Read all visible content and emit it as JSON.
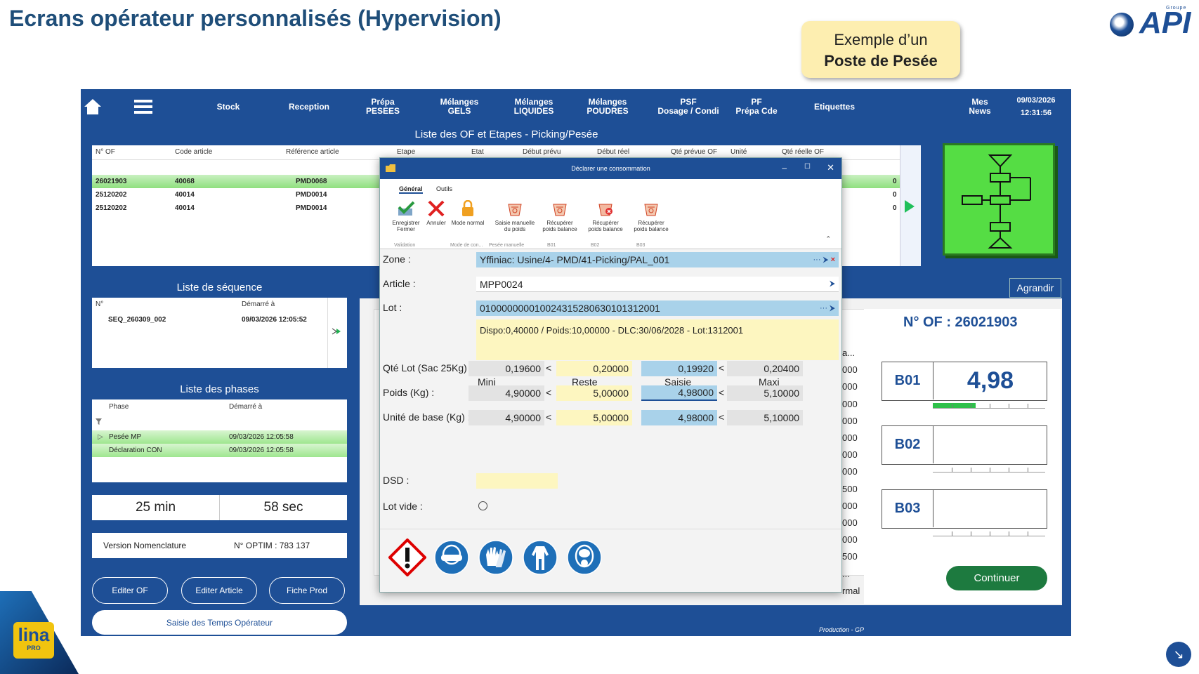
{
  "slide": {
    "title": "Ecrans opérateur personnalisés (Hypervision)",
    "callout_line1": "Exemple d’un",
    "callout_line2": "Poste de Pesée",
    "logo_text": "API",
    "logo_group": "Groupe",
    "lina": "lina",
    "lina_sub": "PRO"
  },
  "nav": {
    "items": [
      "Stock",
      "Reception",
      "Prépa\nPESEES",
      "Mélanges\nGELS",
      "Mélanges\nLIQUIDES",
      "Mélanges\nPOUDRES",
      "PSF\nDosage / Condi",
      "PF\nPrépa Cde",
      "Etiquettes"
    ],
    "news": "Mes\nNews",
    "date": "09/03/2026",
    "time": "12:31:56"
  },
  "of_list": {
    "title": "Liste des OF et Etapes - Picking/Pesée",
    "columns": [
      "N° OF",
      "Code article",
      "Référence article",
      "Etape",
      "Etat",
      "Début prévu",
      "Début réel",
      "Qté prévue OF",
      "Unité",
      "Qté réelle OF"
    ],
    "rows": [
      {
        "of": "26021903",
        "code": "40068",
        "ref": "PMD0068",
        "qte": "0"
      },
      {
        "of": "25120202",
        "code": "40014",
        "ref": "PMD0014",
        "qte": "0"
      },
      {
        "of": "25120202",
        "code": "40014",
        "ref": "PMD0014",
        "qte": "0"
      }
    ]
  },
  "sequence": {
    "title": "Liste de séquence",
    "col_n": "N°",
    "col_start": "Démarré à",
    "row_n": "SEQ_260309_002",
    "row_start": "09/03/2026 12:05:52"
  },
  "phases": {
    "title": "Liste des phases",
    "col_phase": "Phase",
    "col_start": "Démarré à",
    "rows": [
      {
        "phase": "Pesée  MP",
        "start": "09/03/2026 12:05:58"
      },
      {
        "phase": "Déclaration CON",
        "start": "09/03/2026 12:05:58"
      }
    ]
  },
  "timer": {
    "min": "25 min",
    "sec": "58 sec"
  },
  "info": {
    "version": "Version Nomenclature",
    "optim": "N° OPTIM : 783 137"
  },
  "buttons": {
    "editer_of": "Editer OF",
    "editer_article": "Editer Article",
    "fiche_prod": "Fiche Prod",
    "saisie_temps": "Saisie des Temps Opérateur",
    "agrandir": "Agrandir",
    "continuer": "Continuer"
  },
  "right": {
    "of_label": "N° OF : 26021903",
    "footer": "Production - GP",
    "balances": [
      {
        "name": "B01",
        "value": "4,98",
        "fill": 0.38
      },
      {
        "name": "B02",
        "value": "",
        "fill": 0
      },
      {
        "name": "B03",
        "value": "",
        "fill": 0
      }
    ]
  },
  "background_values": [
    "a...",
    "000",
    "000",
    "000",
    "000",
    "000",
    "000",
    "000",
    "500",
    "000",
    "000",
    "000",
    "500",
    "...",
    "rmal"
  ],
  "dialog": {
    "title": "Déclarer une consommation",
    "tabs": [
      "Général",
      "Outils"
    ],
    "ribbon": [
      {
        "label": "Enregistrer\nFermer",
        "icon": "save-check-icon"
      },
      {
        "label": "Annuler",
        "icon": "cancel-x-icon"
      },
      {
        "label": "Mode normal",
        "icon": "lock-icon"
      },
      {
        "label": "Saisie manuelle\ndu poids",
        "icon": "scale-icon"
      },
      {
        "label": "Récupérer\npoids balance",
        "icon": "scale-icon"
      },
      {
        "label": "Récupérer\npoids balance",
        "icon": "scale-error-icon"
      },
      {
        "label": "Récupérer\npoids balance",
        "icon": "scale-icon"
      }
    ],
    "groups": [
      "Validation",
      "Mode de con...",
      "Pesée manuelle",
      "B01",
      "B02",
      "B03"
    ],
    "zone_label": "Zone :",
    "zone_value": "Yffiniac: Usine/4- PMD/41-Picking/PAL_001",
    "article_label": "Article :",
    "article_value": "MPP0024",
    "lot_label": "Lot :",
    "lot_value": "0100000000100243152806301013120​01",
    "info_text": "Dispo:0,40000 / Poids:10,00000 - DLC:30/06/2028 - Lot:1312001",
    "col_mini": "Mini",
    "col_reste": "Reste",
    "col_saisie": "Saisie",
    "col_maxi": "Maxi",
    "rows": [
      {
        "label": "Qté Lot (Sac 25Kg) :",
        "mini": "0,19600",
        "reste": "0,20000",
        "saisie": "0,19920",
        "maxi": "0,20400"
      },
      {
        "label": "Poids (Kg) :",
        "mini": "4,90000",
        "reste": "5,00000",
        "saisie": "4,98000",
        "maxi": "5,10000"
      },
      {
        "label": "Unité de base (Kg) :",
        "mini": "4,90000",
        "reste": "5,00000",
        "saisie": "4,98000",
        "maxi": "5,10000"
      }
    ],
    "lt": "<",
    "dsd_label": "DSD :",
    "lotvide_label": "Lot vide :",
    "ppe_icons": [
      "hazard-icon",
      "goggles-icon",
      "gloves-icon",
      "coverall-icon",
      "mask-icon"
    ]
  }
}
